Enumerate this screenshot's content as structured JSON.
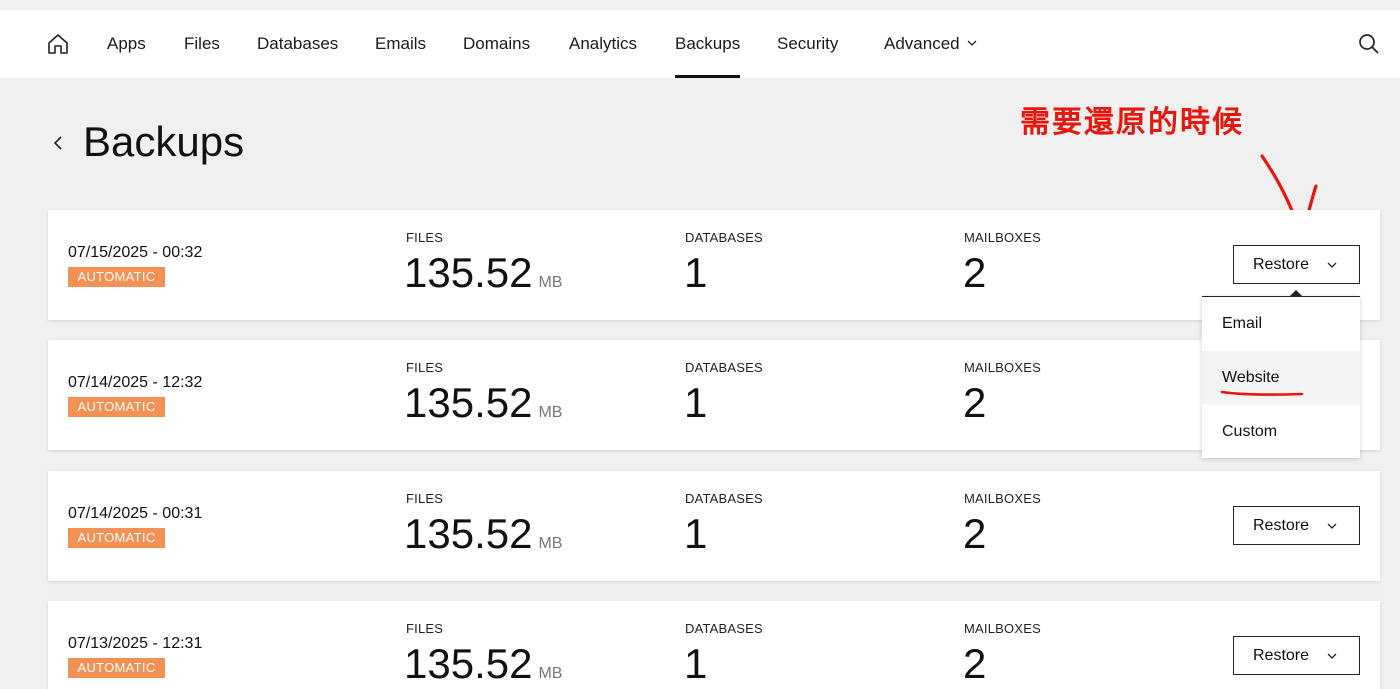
{
  "nav": {
    "items": [
      {
        "label": "Apps"
      },
      {
        "label": "Files"
      },
      {
        "label": "Databases"
      },
      {
        "label": "Emails"
      },
      {
        "label": "Domains"
      },
      {
        "label": "Analytics"
      },
      {
        "label": "Backups",
        "active": true
      },
      {
        "label": "Security"
      },
      {
        "label": "Advanced"
      }
    ],
    "icons": {
      "home": "home-icon",
      "search": "search-icon",
      "advanced": "chevron-down-icon"
    }
  },
  "page": {
    "title": "Backups",
    "annotation": "需要還原的時候"
  },
  "labels": {
    "files": "FILES",
    "databases": "DATABASES",
    "mailboxes": "MAILBOXES",
    "unit": "MB",
    "restore": "Restore"
  },
  "backups": [
    {
      "date": "07/15/2025 - 00:32",
      "badge": "AUTOMATIC",
      "files": "135.52",
      "databases": "1",
      "mailboxes": "2"
    },
    {
      "date": "07/14/2025 - 12:32",
      "badge": "AUTOMATIC",
      "files": "135.52",
      "databases": "1",
      "mailboxes": "2"
    },
    {
      "date": "07/14/2025 - 00:31",
      "badge": "AUTOMATIC",
      "files": "135.52",
      "databases": "1",
      "mailboxes": "2"
    },
    {
      "date": "07/13/2025 - 12:31",
      "badge": "AUTOMATIC",
      "files": "135.52",
      "databases": "1",
      "mailboxes": "2"
    }
  ],
  "restore_menu": {
    "items": [
      {
        "label": "Email"
      },
      {
        "label": "Website",
        "highlighted": true
      },
      {
        "label": "Custom"
      }
    ]
  },
  "colors": {
    "badge": "#f39054",
    "annotation": "#e8160c"
  }
}
